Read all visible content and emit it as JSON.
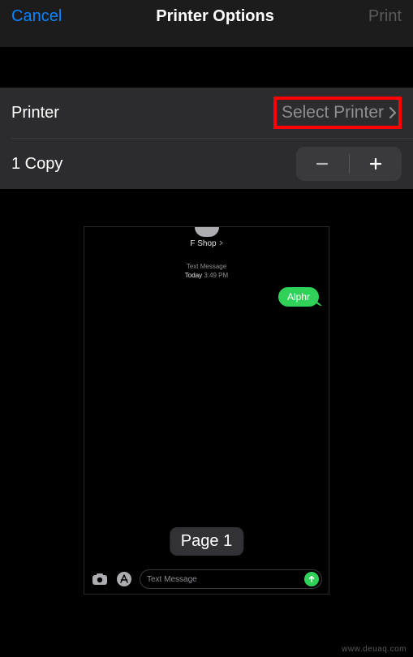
{
  "nav": {
    "cancel": "Cancel",
    "title": "Printer Options",
    "print": "Print"
  },
  "printer_row": {
    "label": "Printer",
    "value": "Select Printer"
  },
  "copies_row": {
    "label": "1 Copy"
  },
  "preview": {
    "contact": "F Shop",
    "meta_line1": "Text Message",
    "meta_today": "Today",
    "meta_time": "3:49 PM",
    "bubble_text": "Alphr",
    "page_badge": "Page 1",
    "compose_placeholder": "Text Message"
  },
  "watermark": "www.deuaq.com"
}
